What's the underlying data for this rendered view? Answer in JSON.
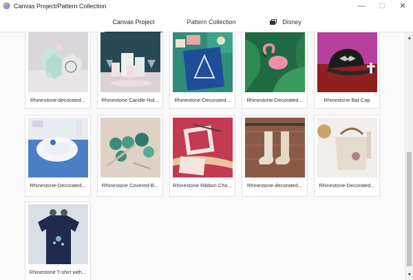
{
  "window": {
    "title": "Canvas Project/Pattern Collection",
    "controls": {
      "minimize": "—",
      "maximize": "☐",
      "close": "✕"
    }
  },
  "tabs": [
    {
      "label": "Canvas Project",
      "active": true
    },
    {
      "label": "Pattern Collection",
      "active": false
    },
    {
      "label": "Disney",
      "active": false,
      "icon": "gallery-icon"
    }
  ],
  "projects": [
    {
      "label": "Rhinestone-decorated...",
      "image": "gift-boxes-photo"
    },
    {
      "label": "Rhinestone Candle Hol...",
      "image": "candle-holders-photo"
    },
    {
      "label": "Rhinestone-Decorated...",
      "image": "tray-photo"
    },
    {
      "label": "Rhinestone-Decorated...",
      "image": "flamingo-photo"
    },
    {
      "label": "Rhinestone Bat Cap",
      "image": "bat-cap-photo"
    },
    {
      "label": "Rhinestone-Decorated...",
      "image": "place-setting-photo"
    },
    {
      "label": "Rhinestone Covered-B...",
      "image": "buttons-photo"
    },
    {
      "label": "Rhinestone Ribbon Cho...",
      "image": "ribbon-photo"
    },
    {
      "label": "Rhinestone-decorated...",
      "image": "stockings-photo"
    },
    {
      "label": "Rhinestone-Decorated...",
      "image": "bag-photo"
    },
    {
      "label": "Rhinestone T-shirt with...",
      "image": "tshirt-photo"
    }
  ],
  "scrollbar": {
    "up_arrow": "▲",
    "down_arrow": "▼"
  }
}
